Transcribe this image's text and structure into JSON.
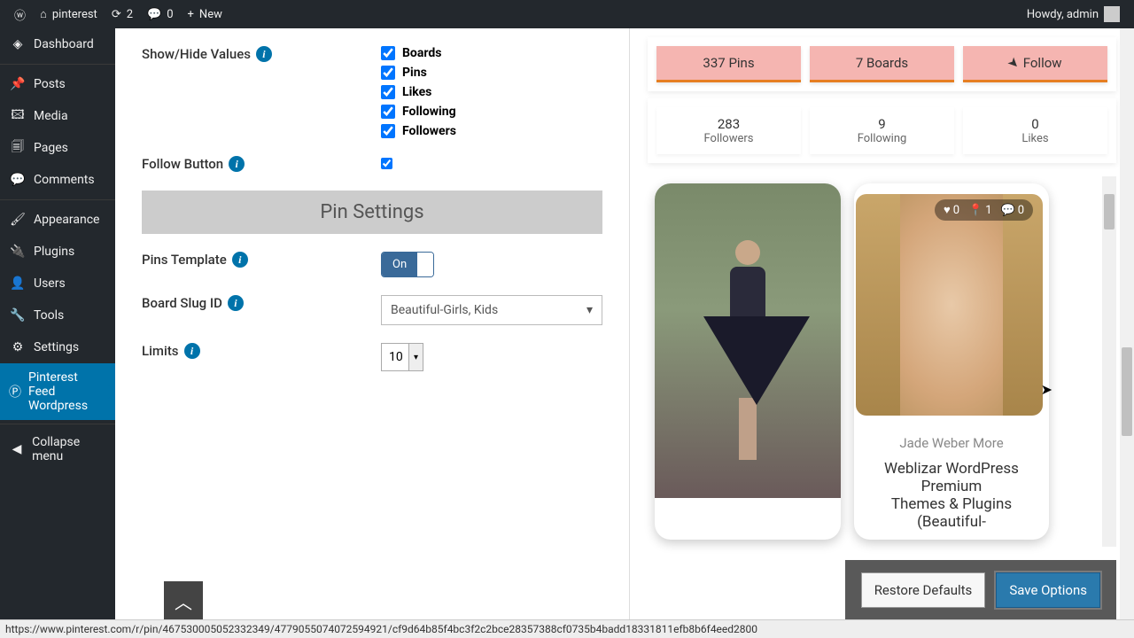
{
  "adminbar": {
    "site_name": "pinterest",
    "updates_count": "2",
    "comments_count": "0",
    "new_label": "New",
    "howdy": "Howdy, admin"
  },
  "sidebar": {
    "items": [
      {
        "label": "Dashboard"
      },
      {
        "label": "Posts"
      },
      {
        "label": "Media"
      },
      {
        "label": "Pages"
      },
      {
        "label": "Comments"
      },
      {
        "label": "Appearance"
      },
      {
        "label": "Plugins"
      },
      {
        "label": "Users"
      },
      {
        "label": "Tools"
      },
      {
        "label": "Settings"
      },
      {
        "label": "Pinterest Feed Wordpress"
      },
      {
        "label": "Collapse menu"
      }
    ]
  },
  "settings": {
    "show_hide_label": "Show/Hide Values",
    "checkboxes": {
      "boards": "Boards",
      "pins": "Pins",
      "likes": "Likes",
      "following": "Following",
      "followers": "Followers"
    },
    "follow_button_label": "Follow Button",
    "pin_settings_header": "Pin Settings",
    "pins_template_label": "Pins Template",
    "toggle_on": "On",
    "board_slug_label": "Board Slug ID",
    "board_slug_value": "Beautiful-Girls, Kids",
    "limits_label": "Limits",
    "limits_value": "10"
  },
  "preview": {
    "stats_top": [
      {
        "num": "337",
        "label": " Pins"
      },
      {
        "num": "7",
        "label": " Boards"
      },
      {
        "label": "Follow"
      }
    ],
    "stats_bottom": [
      {
        "num": "283",
        "label": "Followers"
      },
      {
        "num": "9",
        "label": "Following"
      },
      {
        "num": "0",
        "label": "Likes"
      }
    ],
    "pin2": {
      "hearts": "0",
      "pins": "1",
      "comments": "0",
      "caption": "Jade Weber More",
      "desc1": "Weblizar WordPress Premium",
      "desc2": "Themes & Plugins (Beautiful-"
    }
  },
  "footer": {
    "restore": "Restore Defaults",
    "save": "Save Options"
  },
  "status_url": "https://www.pinterest.com/r/pin/467530005052332349/4779055074072594921/cf9d64b85f4bc3f2c2bce28357388cf0735b4badd18331811efb8b6f4eed2800"
}
